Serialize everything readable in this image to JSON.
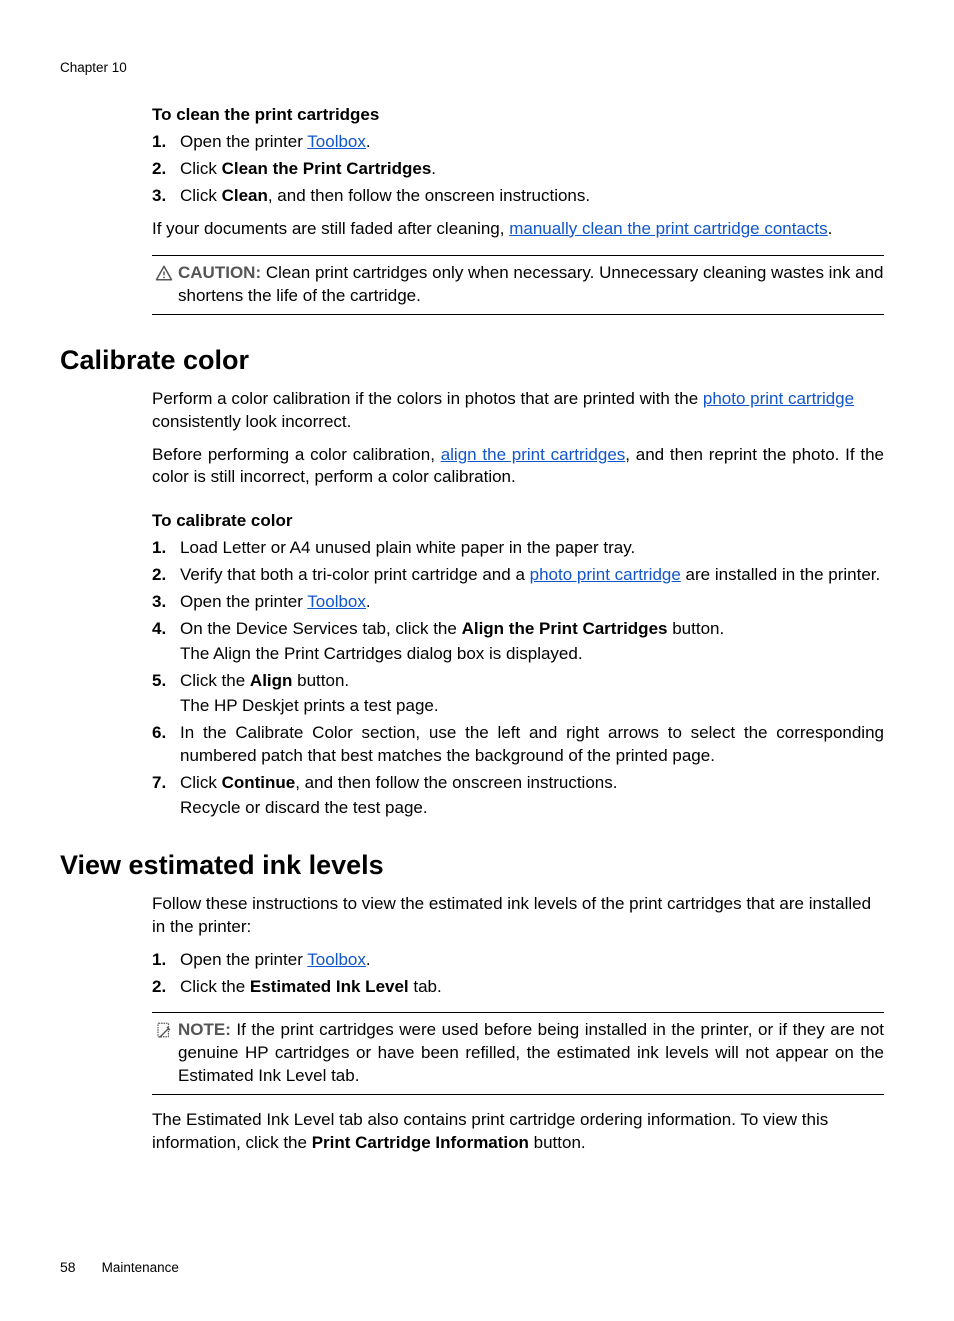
{
  "chapter_header": "Chapter 10",
  "clean": {
    "heading": "To clean the print cartridges",
    "step1_num": "1.",
    "step1_pre": "Open the printer ",
    "step1_link": "Toolbox",
    "step1_post": ".",
    "step2_num": "2.",
    "step2_pre": "Click ",
    "step2_bold": "Clean the Print Cartridges",
    "step2_post": ".",
    "step3_num": "3.",
    "step3_pre": "Click ",
    "step3_bold": "Clean",
    "step3_post": ", and then follow the onscreen instructions.",
    "post_para_pre": "If your documents are still faded after cleaning, ",
    "post_para_link": "manually clean the print cartridge contacts",
    "post_para_post": ".",
    "caution_label": "CAUTION:",
    "caution_text": "  Clean print cartridges only when necessary. Unnecessary cleaning wastes ink and shortens the life of the cartridge."
  },
  "calibrate": {
    "heading": "Calibrate color",
    "intro_pre": "Perform a color calibration if the colors in photos that are printed with the ",
    "intro_link": "photo print cartridge",
    "intro_post": " consistently look incorrect.",
    "before_pre": "Before performing a color calibration, ",
    "before_link": "align the print cartridges",
    "before_post": ", and then reprint the photo. If the color is still incorrect, perform a color calibration.",
    "subheading": "To calibrate color",
    "s1_num": "1.",
    "s1_text": "Load Letter or A4 unused plain white paper in the paper tray.",
    "s2_num": "2.",
    "s2_pre": "Verify that both a tri-color print cartridge and a ",
    "s2_link": "photo print cartridge",
    "s2_post": " are installed in the printer.",
    "s3_num": "3.",
    "s3_pre": "Open the printer ",
    "s3_link": "Toolbox",
    "s3_post": ".",
    "s4_num": "4.",
    "s4_pre": "On the Device Services tab, click the ",
    "s4_bold": "Align the Print Cartridges",
    "s4_post": " button.",
    "s4_sub": "The Align the Print Cartridges dialog box is displayed.",
    "s5_num": "5.",
    "s5_pre": "Click the ",
    "s5_bold": "Align",
    "s5_post": " button.",
    "s5_sub": "The HP Deskjet prints a test page.",
    "s6_num": "6.",
    "s6_text": "In the Calibrate Color section, use the left and right arrows to select the corresponding numbered patch that best matches the background of the printed page.",
    "s7_num": "7.",
    "s7_pre": "Click ",
    "s7_bold": "Continue",
    "s7_post": ", and then follow the onscreen instructions.",
    "s7_sub": "Recycle or discard the test page."
  },
  "ink": {
    "heading": "View estimated ink levels",
    "intro": "Follow these instructions to view the estimated ink levels of the print cartridges that are installed in the printer:",
    "s1_num": "1.",
    "s1_pre": "Open the printer ",
    "s1_link": "Toolbox",
    "s1_post": ".",
    "s2_num": "2.",
    "s2_pre": "Click the ",
    "s2_bold": "Estimated Ink Level",
    "s2_post": " tab.",
    "note_label": "NOTE:",
    "note_text": "  If the print cartridges were used before being installed in the printer, or if they are not genuine HP cartridges or have been refilled, the estimated ink levels will not appear on the Estimated Ink Level tab.",
    "post_pre": "The Estimated Ink Level tab also contains print cartridge ordering information. To view this information, click the ",
    "post_bold": "Print Cartridge Information",
    "post_post": " button."
  },
  "footer": {
    "page": "58",
    "section": "Maintenance"
  }
}
